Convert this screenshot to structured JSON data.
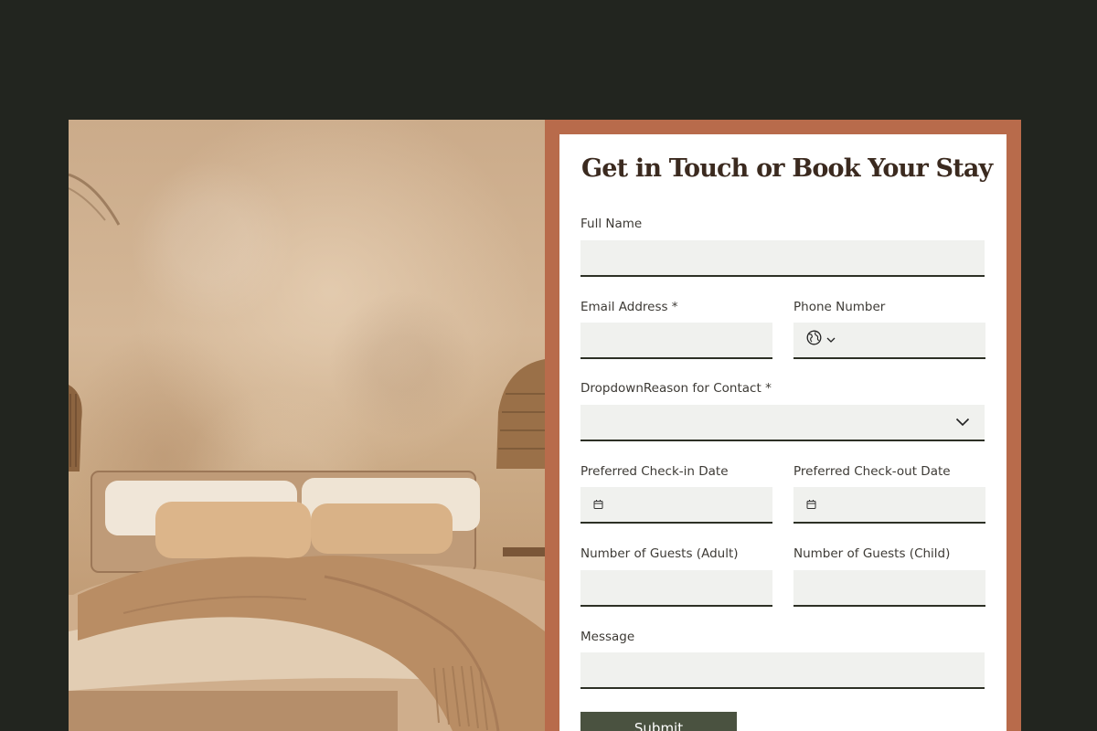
{
  "form": {
    "title": "Get in Touch or Book Your Stay",
    "full_name_label": "Full Name",
    "email_label": "Email Address *",
    "phone_label": "Phone Number",
    "reason_label": "DropdownReason for Contact *",
    "checkin_label": "Preferred Check-in Date",
    "checkout_label": "Preferred Check-out Date",
    "adults_label": "Number of Guests (Adult)",
    "children_label": "Number of Guests (Child)",
    "message_label": "Message",
    "submit_label": "Submit"
  },
  "icons": {
    "phone_country": "globe-icon",
    "phone_chevron": "chevron-down-icon",
    "reason_chevron": "chevron-down-icon",
    "checkin": "calendar-icon",
    "checkout": "calendar-icon"
  },
  "colors": {
    "page_background": "#22251f",
    "frame": "#b86b4b",
    "field_background": "#f0f1ee",
    "button": "#4a5240",
    "title": "#3b2a1f"
  }
}
